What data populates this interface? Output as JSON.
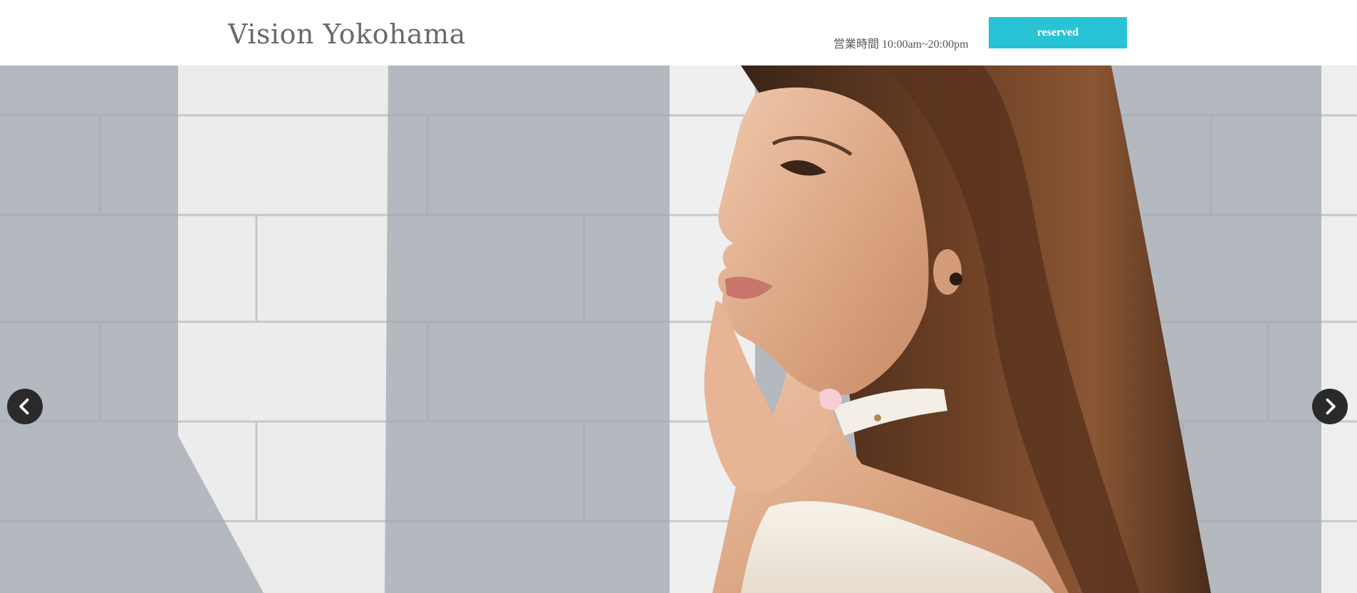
{
  "header": {
    "logo": "Vision Yokohama",
    "hours": "営業時間 10:00am~20:00pm",
    "reserve_label": "reserved"
  },
  "hero": {
    "image_alt": "",
    "prev_icon": "chevron-left-icon",
    "next_icon": "chevron-right-icon"
  },
  "colors": {
    "accent": "#28c3d4",
    "logo_text": "#6a6a6a",
    "arrow_bg": "#2a2a2a"
  }
}
